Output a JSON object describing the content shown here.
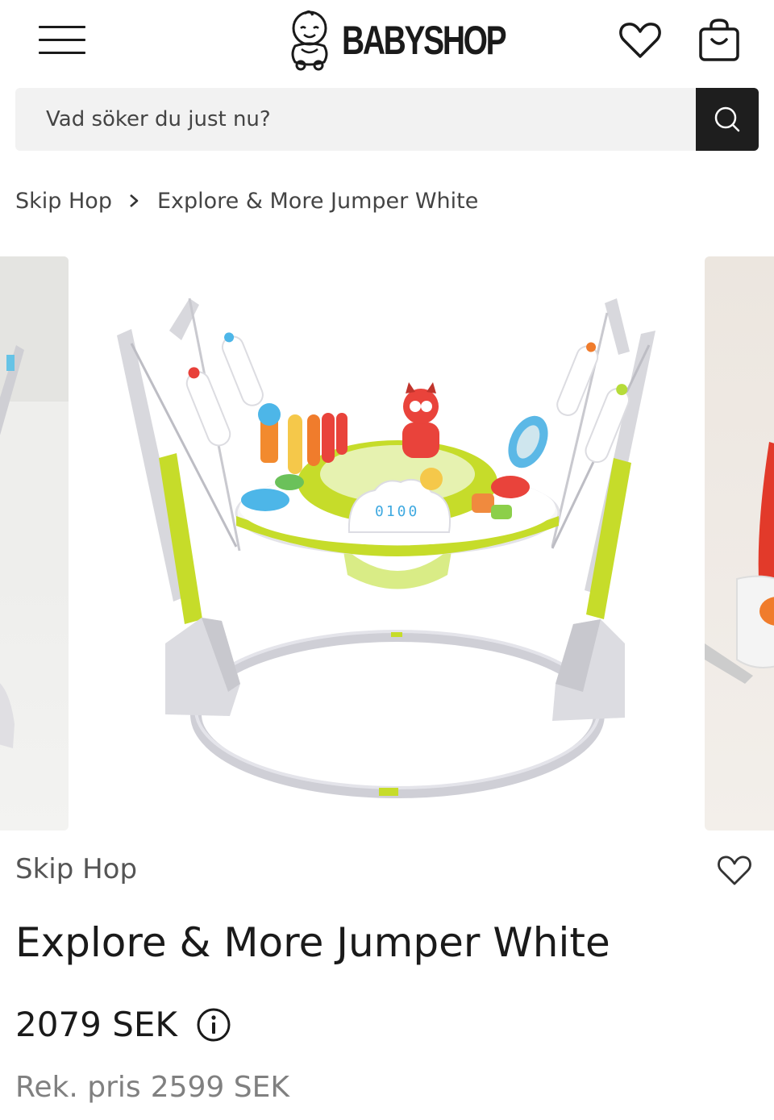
{
  "header": {
    "menu_icon": "hamburger-menu-icon",
    "logo_text": "BABYSHOP",
    "wishlist_icon": "heart-icon",
    "cart_icon": "shopping-bag-icon"
  },
  "search": {
    "placeholder": "Vad söker du just nu?",
    "button_icon": "search-icon"
  },
  "breadcrumb": {
    "items": [
      "Skip Hop",
      "Explore & More Jumper White"
    ],
    "separator_icon": "chevron-right-icon"
  },
  "product": {
    "brand": "Skip Hop",
    "name": "Explore & More Jumper White",
    "price": "2079 SEK",
    "rrp_label": "Rek. pris",
    "rrp_value": "2599 SEK",
    "display_value": "0100",
    "favorite_icon": "heart-outline-icon",
    "info_icon": "info-icon"
  },
  "colors": {
    "search_bg": "#f2f2f2",
    "search_button": "#1e1e1e",
    "muted_text": "#808080",
    "frame_lime": "#c6dc2a"
  }
}
